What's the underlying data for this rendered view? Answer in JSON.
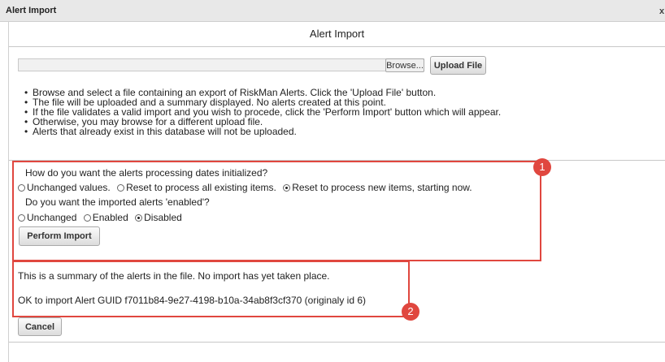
{
  "window": {
    "title": "Alert Import",
    "close_label": "x"
  },
  "page": {
    "heading": "Alert Import"
  },
  "upload": {
    "browse_label": "Browse...",
    "upload_label": "Upload File"
  },
  "instructions": [
    "Browse and select a file containing an export of RiskMan Alerts. Click the 'Upload File' button.",
    "The file will be uploaded and a summary displayed. No alerts created at this point.",
    "If the file validates a valid import and you wish to procede, click the 'Perform Import' button which will appear.",
    "Otherwise, you may browse for a different upload file.",
    "Alerts that already exist in this database will not be uploaded."
  ],
  "dates": {
    "question": "How do you want the alerts processing dates initialized?",
    "options": [
      {
        "label": "Unchanged values.",
        "selected": false
      },
      {
        "label": "Reset to process all existing items.",
        "selected": false
      },
      {
        "label": "Reset to process new items, starting now.",
        "selected": true
      }
    ]
  },
  "enabled": {
    "question": "Do you want the imported alerts 'enabled'?",
    "options": [
      {
        "label": "Unchanged",
        "selected": false
      },
      {
        "label": "Enabled",
        "selected": false
      },
      {
        "label": "Disabled",
        "selected": true
      }
    ]
  },
  "perform_label": "Perform Import",
  "summary": {
    "intro": "This is a summary of the alerts in the file. No import has yet taken place.",
    "line": "OK to import Alert GUID f7011b84-9e27-4198-b10a-34ab8f3cf370 (originaly id 6)"
  },
  "cancel_label": "Cancel",
  "markers": [
    "1",
    "2"
  ],
  "colors": {
    "annotation_red": "#e0473f",
    "titlebar": "#e8e8e8"
  }
}
